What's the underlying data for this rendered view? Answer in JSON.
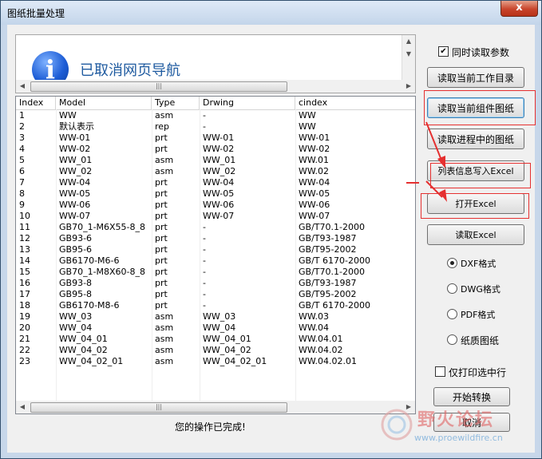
{
  "window": {
    "title": "图纸批量处理",
    "close_label": "x"
  },
  "browser": {
    "message": "已取消网页导航"
  },
  "table": {
    "columns": [
      "Index",
      "Model",
      "Type",
      "Drwing",
      "cindex"
    ],
    "rows": [
      [
        "1",
        "WW",
        "asm",
        "-",
        "WW"
      ],
      [
        "2",
        "默认表示",
        "rep",
        "-",
        "WW"
      ],
      [
        "3",
        "WW-01",
        "prt",
        "WW-01",
        "WW-01"
      ],
      [
        "4",
        "WW-02",
        "prt",
        "WW-02",
        "WW-02"
      ],
      [
        "5",
        "WW_01",
        "asm",
        "WW_01",
        "WW.01"
      ],
      [
        "6",
        "WW_02",
        "asm",
        "WW_02",
        "WW.02"
      ],
      [
        "7",
        "WW-04",
        "prt",
        "WW-04",
        "WW-04"
      ],
      [
        "8",
        "WW-05",
        "prt",
        "WW-05",
        "WW-05"
      ],
      [
        "9",
        "WW-06",
        "prt",
        "WW-06",
        "WW-06"
      ],
      [
        "10",
        "WW-07",
        "prt",
        "WW-07",
        "WW-07"
      ],
      [
        "11",
        "GB70_1-M6X55-8_8",
        "prt",
        "-",
        "GB/T70.1-2000"
      ],
      [
        "12",
        "GB93-6",
        "prt",
        "-",
        "GB/T93-1987"
      ],
      [
        "13",
        "GB95-6",
        "prt",
        "-",
        "GB/T95-2002"
      ],
      [
        "14",
        "GB6170-M6-6",
        "prt",
        "-",
        "GB/T 6170-2000"
      ],
      [
        "15",
        "GB70_1-M8X60-8_8",
        "prt",
        "-",
        "GB/T70.1-2000"
      ],
      [
        "16",
        "GB93-8",
        "prt",
        "-",
        "GB/T93-1987"
      ],
      [
        "17",
        "GB95-8",
        "prt",
        "-",
        "GB/T95-2002"
      ],
      [
        "18",
        "GB6170-M8-6",
        "prt",
        "-",
        "GB/T 6170-2000"
      ],
      [
        "19",
        "WW_03",
        "asm",
        "WW_03",
        "WW.03"
      ],
      [
        "20",
        "WW_04",
        "asm",
        "WW_04",
        "WW.04"
      ],
      [
        "21",
        "WW_04_01",
        "asm",
        "WW_04_01",
        "WW.04.01"
      ],
      [
        "22",
        "WW_04_02",
        "asm",
        "WW_04_02",
        "WW.04.02"
      ],
      [
        "23",
        "WW_04_02_01",
        "asm",
        "WW_04_02_01",
        "WW.04.02.01"
      ]
    ]
  },
  "status_text": "您的操作已完成!",
  "controls": {
    "read_params_label": "同时读取参数",
    "btn_read_workdir": "读取当前工作目录",
    "btn_read_drawings": "读取当前组件图纸",
    "btn_read_session": "读取进程中的图纸",
    "btn_write_excel": "列表信息写入Excel",
    "btn_open_excel": "打开Excel",
    "btn_read_excel": "读取Excel",
    "fmt_dxf": "DXF格式",
    "fmt_dwg": "DWG格式",
    "fmt_pdf": "PDF格式",
    "fmt_paper": "纸质图纸",
    "print_selected_label": "仅打印选中行",
    "btn_start": "开始转换",
    "btn_cancel": "取消"
  },
  "watermark": {
    "text": "野火论坛",
    "url": "www.proewildfire.cn"
  },
  "colors": {
    "annotation_red": "#e53030",
    "link_blue": "#1f5ba0"
  }
}
